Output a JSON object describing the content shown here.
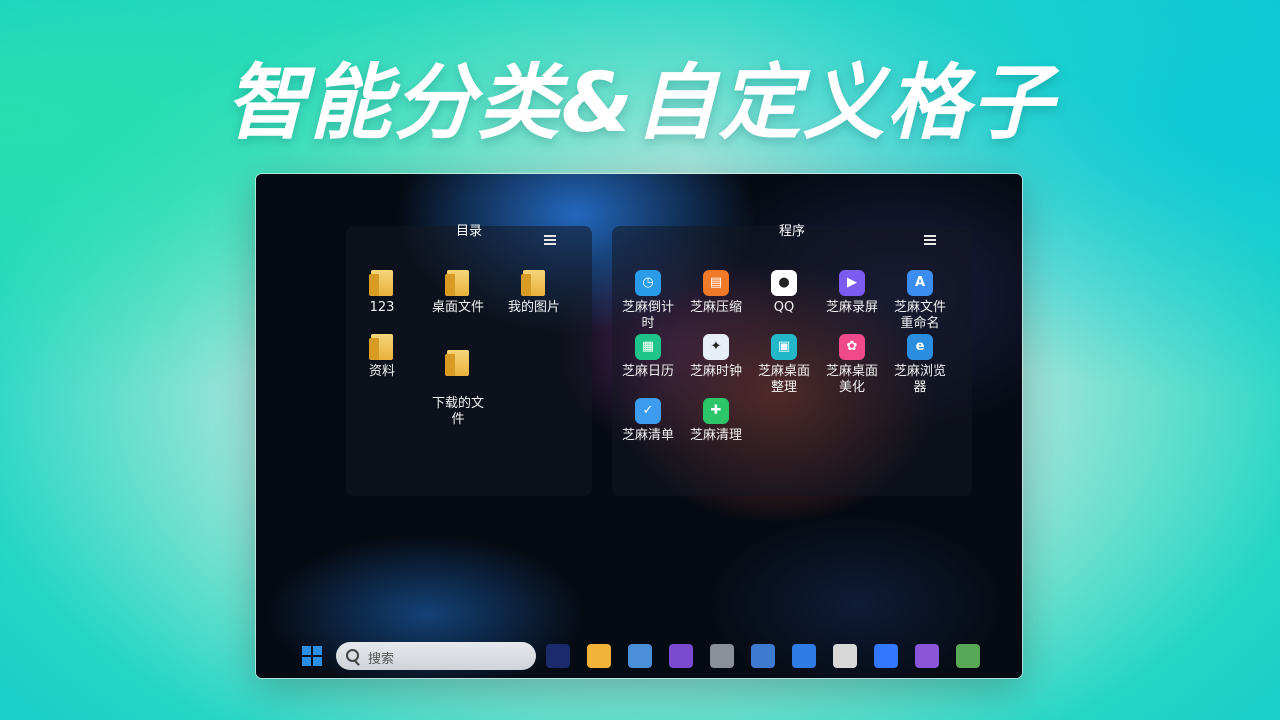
{
  "headline": "智能分类&自定义格子",
  "desktop": {
    "fence_left": {
      "title": "目录",
      "prev": "‹",
      "next": "›",
      "items": [
        {
          "label": "123"
        },
        {
          "label": "桌面文件"
        },
        {
          "label": "我的图片"
        },
        {
          "label": "资料"
        },
        {
          "label": "下载的文\n件"
        }
      ]
    },
    "fence_right": {
      "title": "程序",
      "prev": "‹",
      "next": "›",
      "items": [
        {
          "label": "芝麻倒计\n时",
          "icon": "countdown-icon",
          "color": "#2a9be8"
        },
        {
          "label": "芝麻压缩",
          "icon": "compress-icon",
          "color": "#f07a2a"
        },
        {
          "label": "QQ",
          "icon": "qq-icon",
          "color": "#ffffff"
        },
        {
          "label": "芝麻录屏",
          "icon": "record-icon",
          "color": "#7b5cf0"
        },
        {
          "label": "芝麻文件\n重命名",
          "icon": "rename-icon",
          "color": "#3b8ef0"
        },
        {
          "label": "芝麻日历",
          "icon": "calendar-icon",
          "color": "#1fc48a"
        },
        {
          "label": "芝麻时钟",
          "icon": "clock-icon",
          "color": "#e8eef8"
        },
        {
          "label": "芝麻桌面\n整理",
          "icon": "desktop-organize-icon",
          "color": "#22b8c8"
        },
        {
          "label": "芝麻桌面\n美化",
          "icon": "palette-icon",
          "color": "#f04a8a"
        },
        {
          "label": "芝麻浏览\n器",
          "icon": "browser-icon",
          "color": "#2a8de0"
        },
        {
          "label": "芝麻清单",
          "icon": "checklist-icon",
          "color": "#3d9cf0"
        },
        {
          "label": "芝麻清理",
          "icon": "clean-icon",
          "color": "#2cc56a"
        }
      ]
    }
  },
  "taskbar": {
    "search_placeholder": "搜索",
    "apps": [
      {
        "icon": "dev-tool-icon",
        "color": "#1a2a6a"
      },
      {
        "icon": "file-explorer-icon",
        "color": "#f3b33a"
      },
      {
        "icon": "photos-icon",
        "color": "#4a8fd8"
      },
      {
        "icon": "visual-studio-icon",
        "color": "#7a4bd0"
      },
      {
        "icon": "database-icon",
        "color": "#8a8f99"
      },
      {
        "icon": "remote-desktop-icon",
        "color": "#3d7ad0"
      },
      {
        "icon": "todo-icon",
        "color": "#2f7ce6"
      },
      {
        "icon": "paint-icon",
        "color": "#d8d8d8"
      },
      {
        "icon": "feishu-icon",
        "color": "#3377ff"
      },
      {
        "icon": "vs-code-icon",
        "color": "#8a55d8"
      },
      {
        "icon": "image-editor-icon",
        "color": "#58a858"
      }
    ]
  }
}
